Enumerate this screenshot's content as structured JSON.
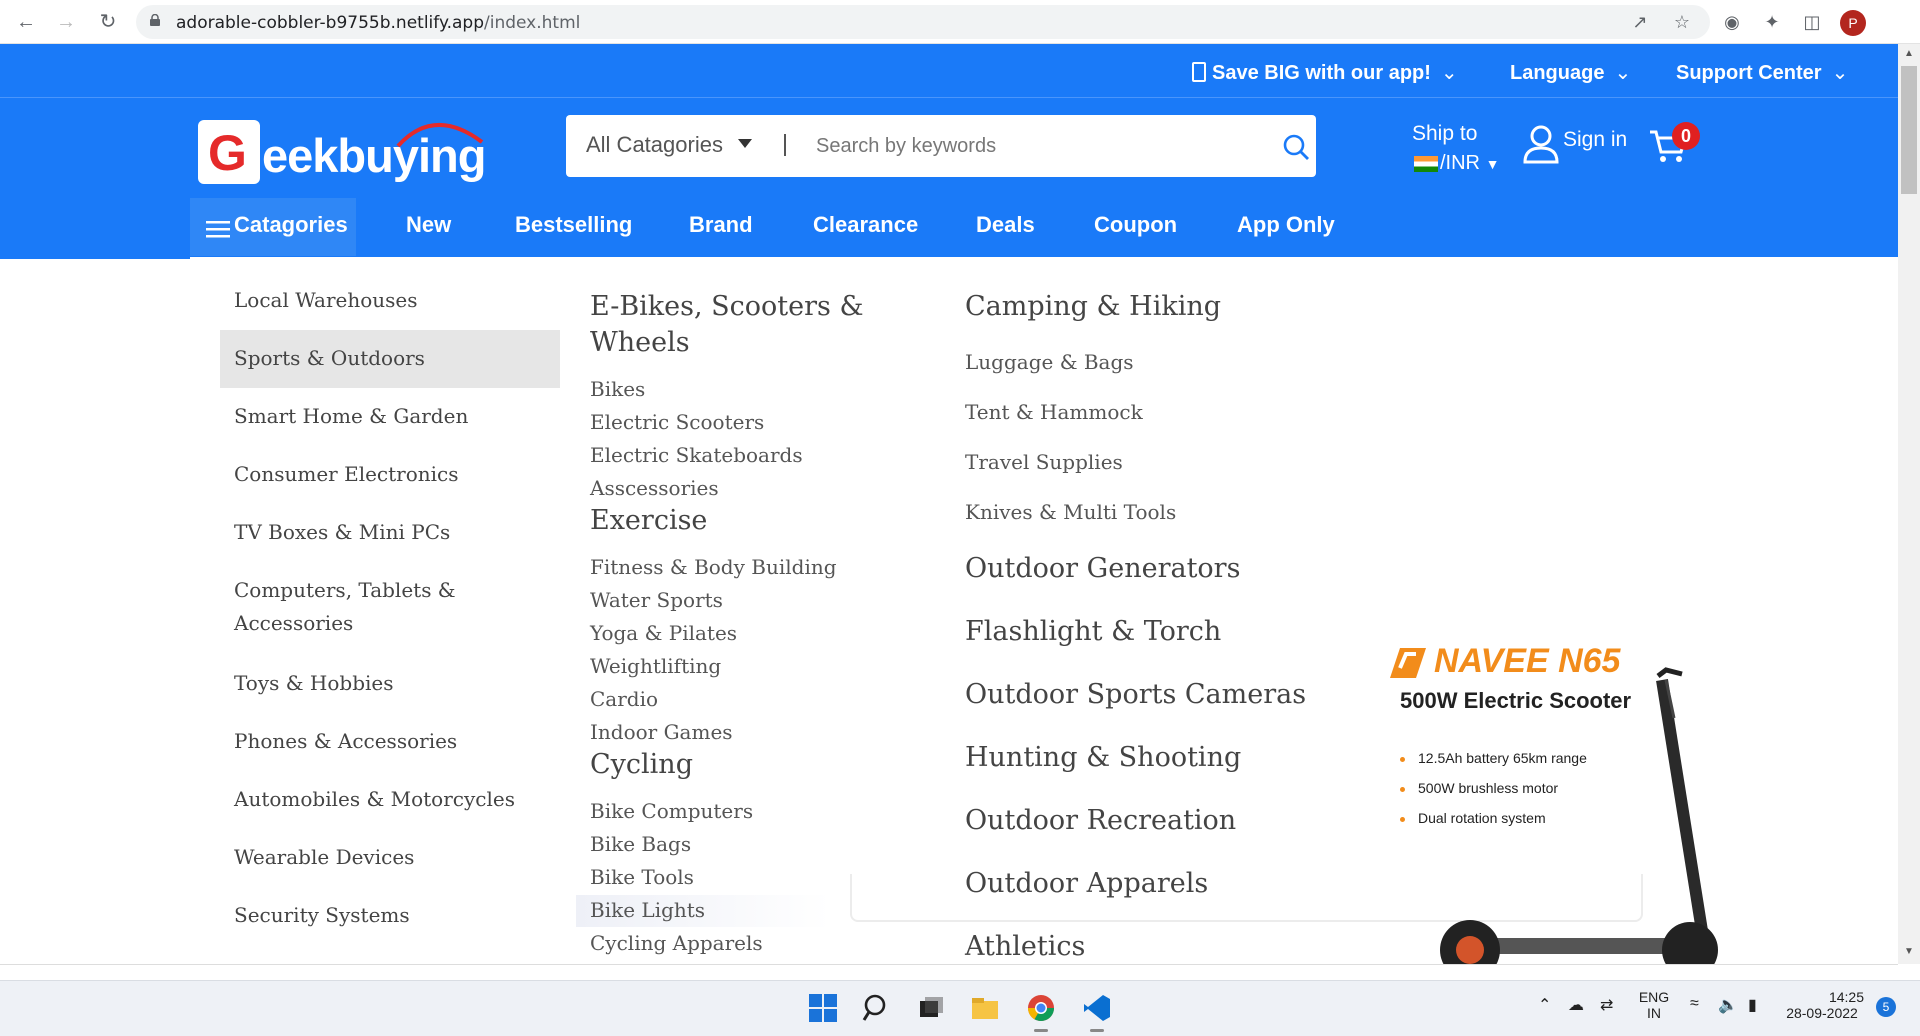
{
  "browser": {
    "url_host": "adorable-cobbler-b9755b.netlify.app",
    "url_path": "/index.html",
    "profile_initial": "P"
  },
  "topbar": {
    "app": "Save BIG with our app!",
    "language": "Language",
    "support": "Support Center"
  },
  "header": {
    "logo": "Geekbuying",
    "search_category": "All Catagories",
    "search_placeholder": "Search by keywords",
    "ship_to": "Ship to",
    "currency": "/INR",
    "sign_in": "Sign in",
    "cart_count": "0"
  },
  "nav": {
    "categories": "Catagories",
    "items": [
      "New",
      "Bestselling",
      "Brand",
      "Clearance",
      "Deals",
      "Coupon",
      "App Only"
    ]
  },
  "menu": {
    "left": [
      "Local Warehouses",
      "Sports & Outdoors",
      "Smart Home & Garden",
      "Consumer Electronics",
      "TV Boxes & Mini PCs",
      "Computers, Tablets &",
      "Accessories",
      "Toys & Hobbies",
      "Phones & Accessories",
      "Automobiles & Motorcycles",
      "Wearable Devices",
      "Security Systems"
    ],
    "col1": {
      "ebikes_head_1": "E-Bikes, Scooters &",
      "ebikes_head_2": "Wheels",
      "ebikes": [
        "Bikes",
        "Electric Scooters",
        "Electric Skateboards",
        "Asscessories"
      ],
      "exercise_head": "Exercise",
      "exercise": [
        "Fitness & Body Building",
        "Water Sports",
        "Yoga & Pilates",
        "Weightlifting",
        "Cardio",
        "Indoor Games"
      ],
      "cycling_head": "Cycling",
      "cycling": [
        "Bike Computers",
        "Bike Bags",
        "Bike Tools",
        "Bike Lights",
        "Cycling Apparels"
      ]
    },
    "col2": {
      "camping_head": "Camping & Hiking",
      "camping": [
        "Luggage & Bags",
        "Tent & Hammock",
        "Travel Supplies",
        "Knives & Multi Tools"
      ],
      "heads": [
        "Outdoor Generators",
        "Flashlight & Torch",
        "Outdoor Sports Cameras",
        "Hunting & Shooting",
        "Outdoor Recreation",
        "Outdoor Apparels",
        "Athletics"
      ]
    }
  },
  "promo": {
    "brand": "NAVEE N65",
    "title": "500W Electric Scooter",
    "features": [
      "12.5Ah battery 65km range",
      "500W brushless motor",
      "Dual rotation system"
    ]
  },
  "taskbar": {
    "lang1": "ENG",
    "lang2": "IN",
    "time": "14:25",
    "date": "28-09-2022",
    "notif": "5"
  },
  "colors": {
    "brand_blue": "#1a7af8",
    "accent_orange": "#f28c1b",
    "badge_red": "#e02020"
  }
}
